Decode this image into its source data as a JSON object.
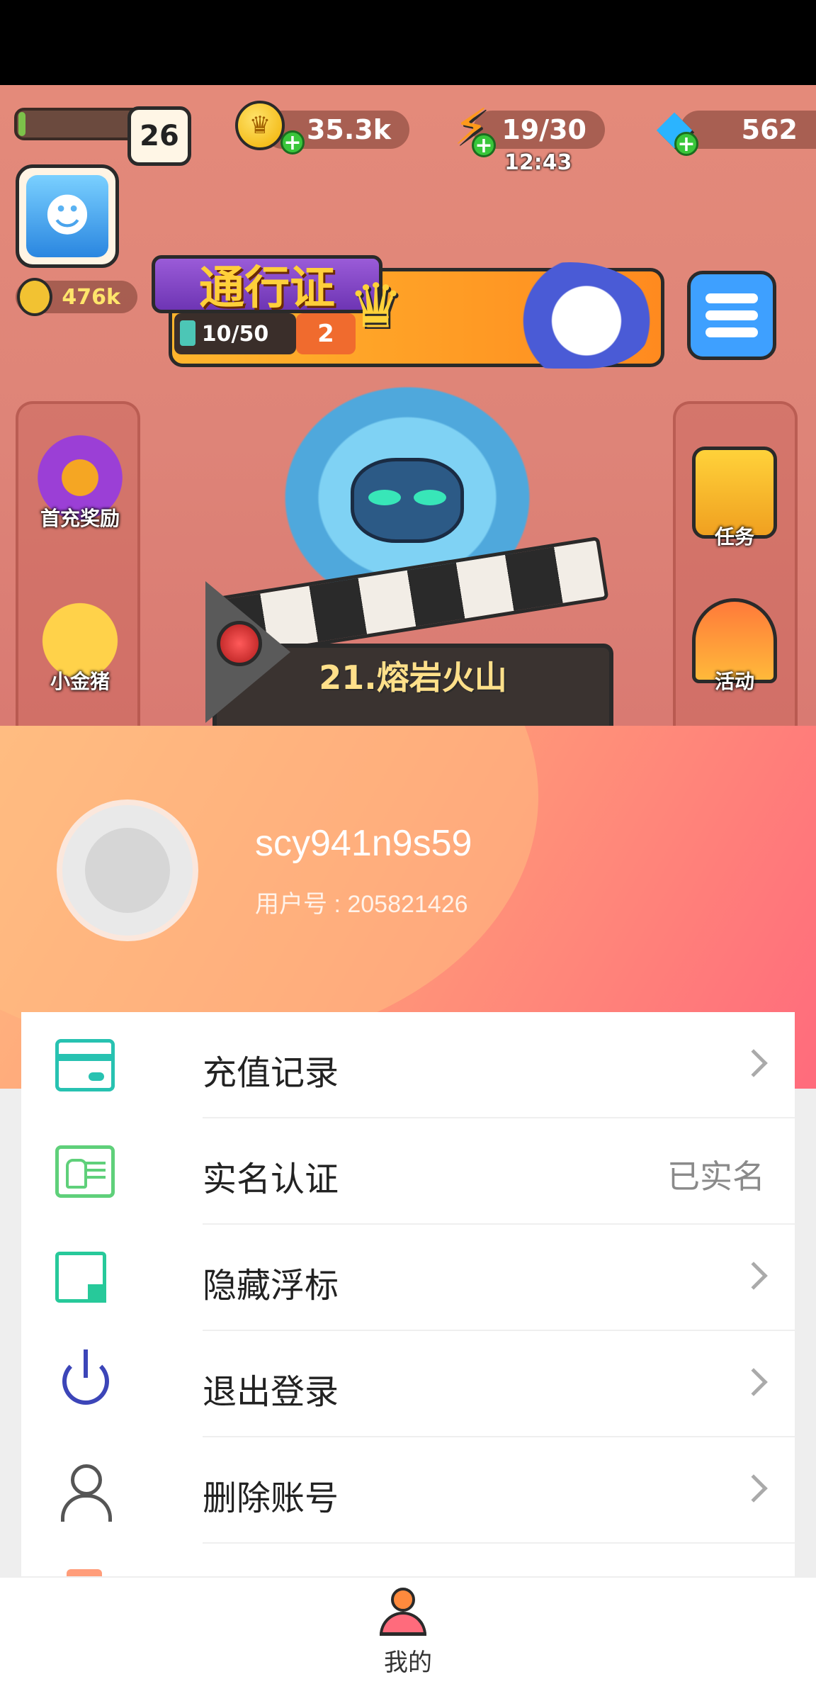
{
  "game": {
    "player_level": "26",
    "level_progress": 0.04,
    "coins": "35.3k",
    "energy": "19/30",
    "energy_timer": "12:43",
    "gems": "562",
    "power": "476k",
    "pass": {
      "title": "通行证",
      "progress": "10/50",
      "level": "2"
    },
    "left_buttons": [
      {
        "label": "首充奖励"
      },
      {
        "label": "小金猪"
      }
    ],
    "right_buttons": [
      {
        "label": "任务"
      },
      {
        "label": "活动"
      }
    ],
    "stage_name": "21.熔岩火山"
  },
  "profile": {
    "username": "scy941n9s59",
    "user_id": "用户号 : 205821426"
  },
  "menu": {
    "items": [
      {
        "label": "充值记录",
        "icon": "card-icon"
      },
      {
        "label": "实名认证",
        "icon": "id-card-icon",
        "status": "已实名"
      },
      {
        "label": "隐藏浮标",
        "icon": "float-window-icon"
      },
      {
        "label": "退出登录",
        "icon": "power-icon"
      },
      {
        "label": "删除账号",
        "icon": "user-icon"
      }
    ]
  },
  "bottom_nav": {
    "label": "我的",
    "icon": "profile-icon"
  },
  "colors": {
    "accent_teal": "#27c2b1",
    "accent_green": "#5fd07a",
    "accent_indigo": "#3c45b8",
    "profile_gradient_start": "#ffbb80",
    "profile_gradient_end": "#ff6b7c"
  }
}
